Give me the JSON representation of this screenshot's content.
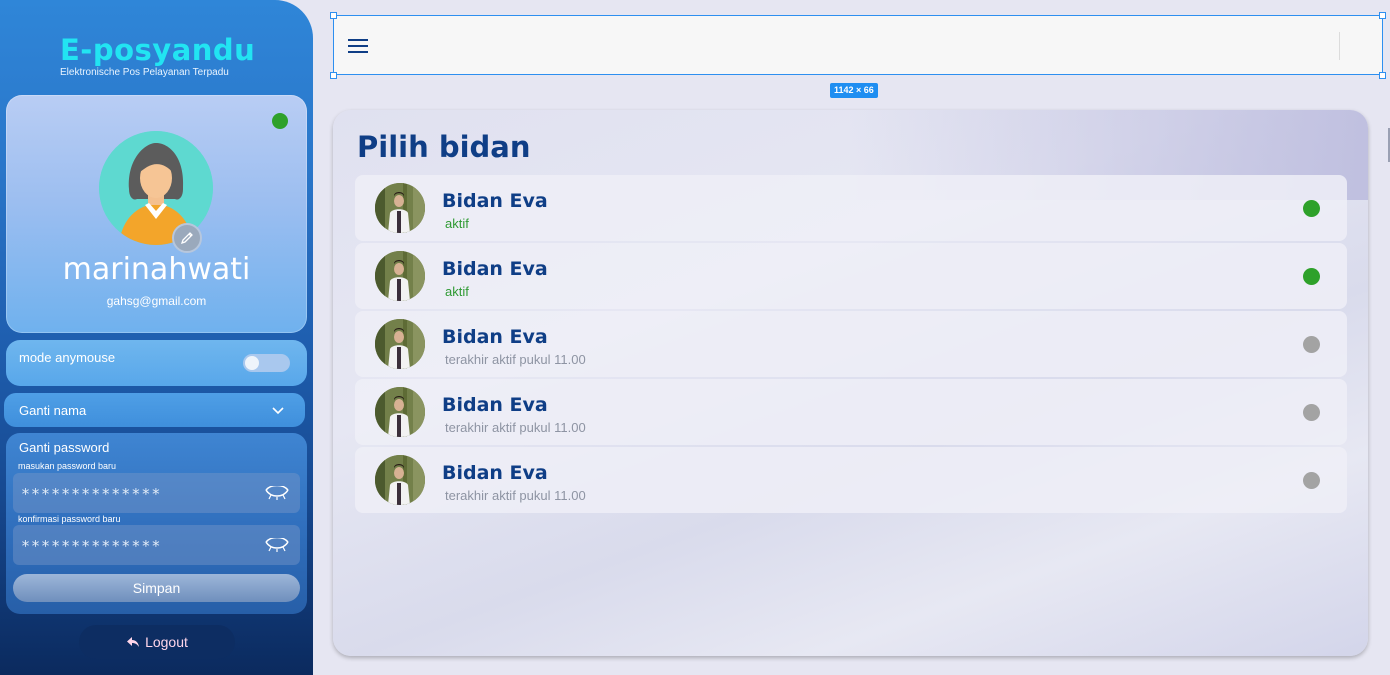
{
  "brand": {
    "title": "E-posyandu",
    "subtitle": "Elektronische Pos Pelayanan Terpadu"
  },
  "profile": {
    "username": "marinahwati",
    "email": "gahsg@gmail.com",
    "online_color": "#2ea12a"
  },
  "settings": {
    "mode_label": "mode anymouse",
    "mode_enabled": false,
    "ganti_nama_label": "Ganti nama",
    "ganti_password_label": "Ganti password",
    "new_password_label": "masukan password baru",
    "new_password_value": "**************",
    "confirm_password_label": "konfirmasi password baru",
    "confirm_password_value": "**************",
    "save_label": "Simpan"
  },
  "logout_label": "Logout",
  "topbar": {
    "dimension_badge": "1142 × 66"
  },
  "main": {
    "title": "Pilih bidan",
    "bidan_list": [
      {
        "name": "Bidan Eva",
        "status": "aktif",
        "online": true
      },
      {
        "name": "Bidan Eva",
        "status": "aktif",
        "online": true
      },
      {
        "name": "Bidan Eva",
        "status": "terakhir aktif pukul 11.00",
        "online": false
      },
      {
        "name": "Bidan Eva",
        "status": "terakhir aktif pukul 11.00",
        "online": false
      },
      {
        "name": "Bidan Eva",
        "status": "terakhir aktif pukul 11.00",
        "online": false
      }
    ]
  },
  "colors": {
    "accent": "#0f3e86",
    "brand": "#22e4f2",
    "online": "#2ea12a",
    "offline": "#a3a3a3",
    "selection": "#2d8ff0"
  },
  "icons": [
    "menu-icon",
    "pencil-icon",
    "chevron-down-icon",
    "eye-closed-icon",
    "reply-arrow-icon"
  ]
}
